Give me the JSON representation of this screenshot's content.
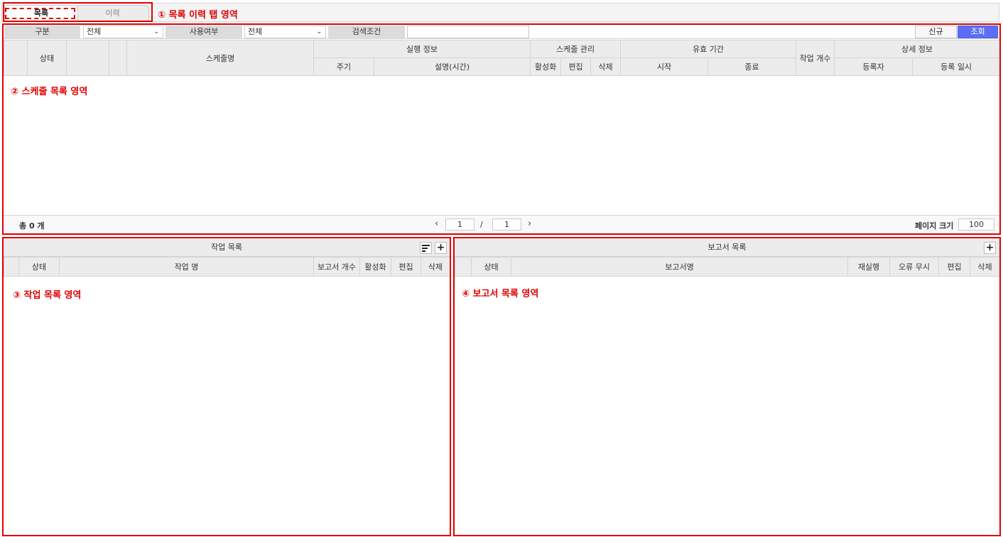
{
  "tabs": {
    "list_label": "목록",
    "history_label": "이력",
    "annotation": "① 목록 이력 탭 영역"
  },
  "filters": {
    "category_label": "구분",
    "category_value": "전체",
    "usage_label": "사용여부",
    "usage_value": "전체",
    "condition_label": "검색조건",
    "condition_value": "",
    "new_button": "신규",
    "search_button": "조회"
  },
  "schedule_grid": {
    "status": "상태",
    "name": "스케줄명",
    "exec_group": "실행 정보",
    "cycle": "주기",
    "description": "설명(시간)",
    "manage_group": "스케줄 관리",
    "activate": "활성화",
    "edit": "편집",
    "delete": "삭제",
    "validity_group": "유효 기간",
    "start": "시작",
    "end": "종료",
    "job_count": "작업 개수",
    "detail_group": "상세 정보",
    "registrant": "등록자",
    "reg_date": "등록 일시",
    "annotation": "② 스케줄 목록 영역"
  },
  "pager": {
    "total": "총 0 개",
    "prev": "‹",
    "current_page": "1",
    "slash": "/",
    "total_pages": "1",
    "next": "›",
    "page_size_label": "페이지 크기",
    "page_size": "100"
  },
  "job_panel": {
    "title": "작업 목록",
    "status": "상태",
    "name": "작업 명",
    "report_count": "보고서 개수",
    "activate": "활성화",
    "edit": "편집",
    "delete": "삭제",
    "annotation": "③ 작업 목록 영역"
  },
  "report_panel": {
    "title": "보고서 목록",
    "status": "상태",
    "name": "보고서명",
    "rerun": "재실행",
    "ignore_error": "오류 무시",
    "edit": "편집",
    "delete": "삭제",
    "annotation": "④ 보고서 목록 영역"
  },
  "colors": {
    "annotation_red": "#e00000",
    "primary_button": "#5b6ef5",
    "header_gray": "#ececec"
  },
  "icons": [
    "sort-icon",
    "plus-icon",
    "chevron-down-icon",
    "chevron-left-icon",
    "chevron-right-icon"
  ]
}
